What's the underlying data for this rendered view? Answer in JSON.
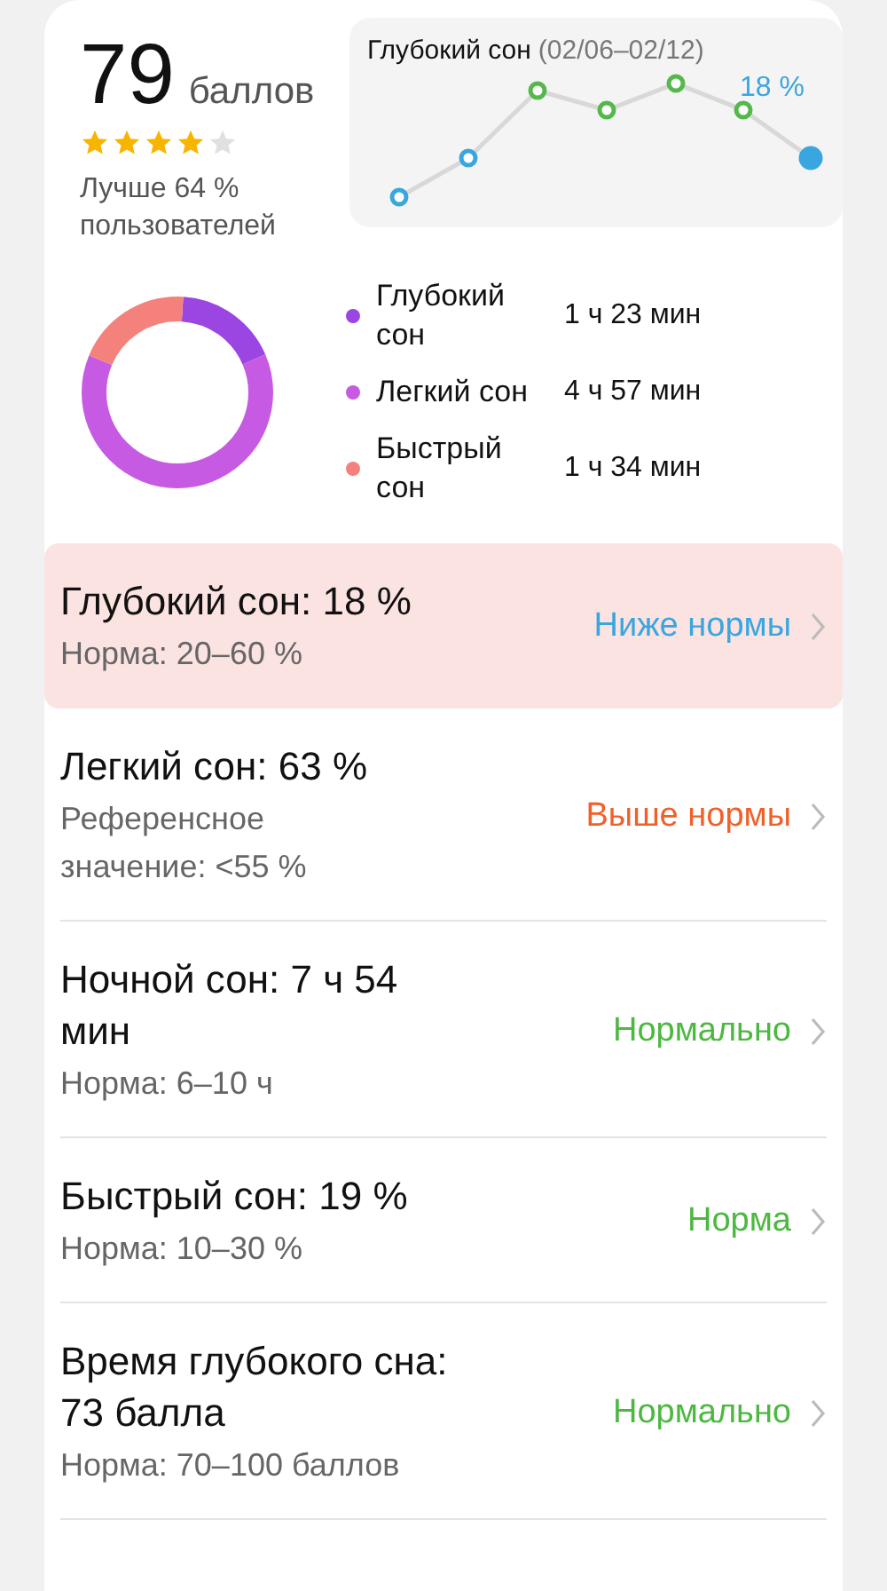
{
  "score": {
    "value": "79",
    "unit": "баллов",
    "stars": 4,
    "comparison": "Лучше 64 % пользователей"
  },
  "trend": {
    "title": "Глубокий сон",
    "range": "(02/06–02/12)",
    "value_label": "18 %"
  },
  "stages": [
    {
      "name": "Глубокий сон",
      "duration": "1 ч 23 мин",
      "color": "#9b45e3",
      "level": 0.175
    },
    {
      "name": "Легкий сон",
      "duration": "4 ч 57 мин",
      "color": "#c65ae2",
      "level": 0.627
    },
    {
      "name": "Быстрый сон",
      "duration": "1 ч 34 мин",
      "color": "#f4817c",
      "level": 0.198
    }
  ],
  "metrics": [
    {
      "title": "Глубокий сон: 18 %",
      "norm": "Норма: 20–60 %",
      "status": "Ниже нормы",
      "color": "#3aa6e0",
      "selected": true
    },
    {
      "title": "Легкий сон: 63 %",
      "norm": "Референсное значение: <55 %",
      "status": "Выше нормы",
      "color": "#f0602a",
      "selected": false
    },
    {
      "title": "Ночной сон: 7 ч 54 мин",
      "norm": "Норма: 6–10 ч",
      "status": "Нормально",
      "color": "#4cb840",
      "selected": false
    },
    {
      "title": "Быстрый сон: 19 %",
      "norm": "Норма: 10–30 %",
      "status": "Норма",
      "color": "#4cb840",
      "selected": false
    },
    {
      "title": "Время глубокого сна: 73 балла",
      "norm": "Норма: 70–100 баллов",
      "status": "Нормально",
      "color": "#4cb840",
      "selected": false
    }
  ]
}
